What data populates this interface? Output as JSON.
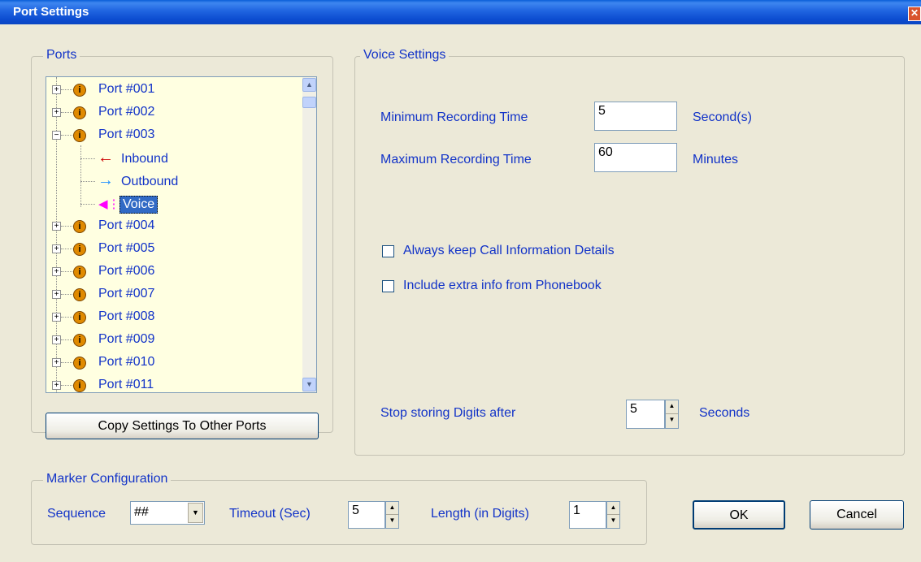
{
  "window": {
    "title": "Port Settings"
  },
  "ports": {
    "group_title": "Ports",
    "tree": {
      "port1": "Port #001",
      "port2": "Port #002",
      "port3": "Port #003",
      "inbound": "Inbound",
      "outbound": "Outbound",
      "voice": "Voice",
      "port4": "Port #004",
      "port5": "Port #005",
      "port6": "Port #006",
      "port7": "Port #007",
      "port8": "Port #008",
      "port9": "Port #009",
      "port10": "Port #010",
      "port11": "Port #011"
    },
    "copy_button": "Copy Settings To Other Ports"
  },
  "voice_settings": {
    "group_title": "Voice Settings",
    "min_label": "Minimum Recording Time",
    "min_value": "5",
    "min_unit": "Second(s)",
    "max_label": "Maximum Recording Time",
    "max_value": "60",
    "max_unit": "Minutes",
    "keep_details_label": "Always keep Call Information Details",
    "keep_details_checked": false,
    "phonebook_label": "Include extra info from Phonebook",
    "phonebook_checked": false,
    "stop_digits_label": "Stop storing Digits after",
    "stop_digits_value": "5",
    "stop_digits_unit": "Seconds"
  },
  "marker": {
    "group_title": "Marker Configuration",
    "sequence_label": "Sequence",
    "sequence_value": "##",
    "timeout_label": "Timeout (Sec)",
    "timeout_value": "5",
    "length_label": "Length (in Digits)",
    "length_value": "1"
  },
  "buttons": {
    "ok": "OK",
    "cancel": "Cancel"
  },
  "colors": {
    "label_blue": "#1233C8",
    "selection": "#316AC5",
    "inbound_red": "#CC0000",
    "outbound_blue": "#1E90FF",
    "voice_magenta": "#FF00FF"
  }
}
